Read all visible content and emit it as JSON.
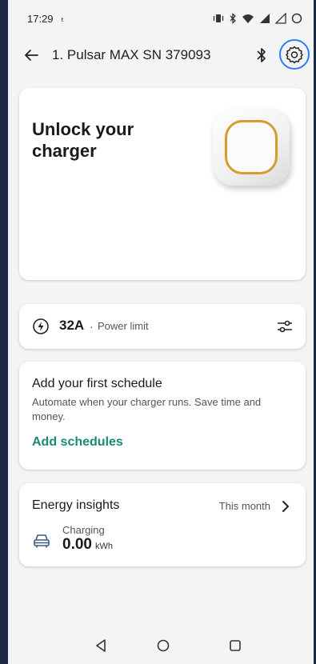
{
  "status_bar": {
    "time": "17:29",
    "network_glyph": "ₜ"
  },
  "app_bar": {
    "title": "1. Pulsar MAX  SN 379093"
  },
  "unlock_card": {
    "title": "Unlock your charger"
  },
  "power_card": {
    "value": "32A",
    "separator": "·",
    "label": "Power limit"
  },
  "schedule_card": {
    "title": "Add your first schedule",
    "description": "Automate when your charger runs. Save time and money.",
    "link": "Add schedules"
  },
  "energy_card": {
    "title": "Energy insights",
    "period": "This month",
    "label": "Charging",
    "value": "0.00",
    "unit": "kWh"
  },
  "colors": {
    "accent_green": "#1b8a74",
    "highlight_blue": "#2f7bf6",
    "charger_ring": "#d79b2e"
  },
  "icons": [
    "back-arrow-icon",
    "bluetooth-icon",
    "settings-gear-icon",
    "power-bolt-icon",
    "sliders-icon",
    "chevron-right-icon",
    "car-icon",
    "nav-back-icon",
    "nav-home-icon",
    "nav-recents-icon"
  ]
}
